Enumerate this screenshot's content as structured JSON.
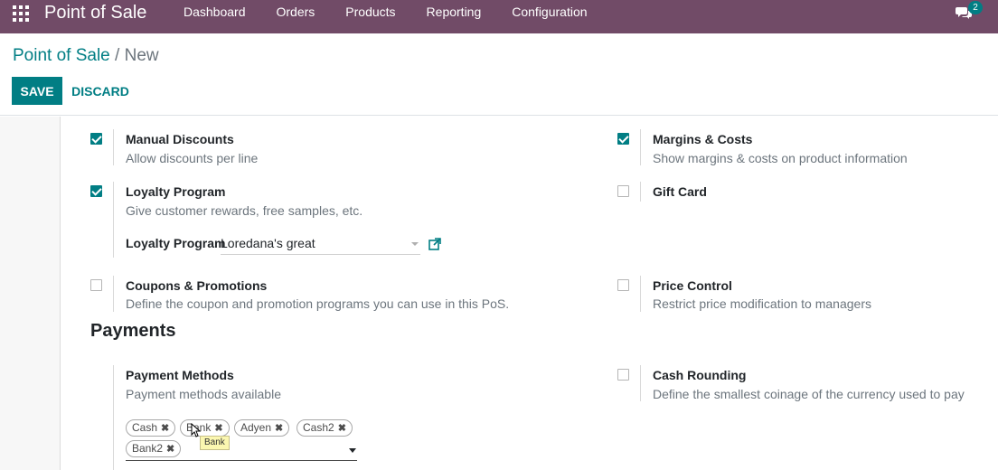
{
  "navbar": {
    "brand": "Point of Sale",
    "menu": [
      "Dashboard",
      "Orders",
      "Products",
      "Reporting",
      "Configuration"
    ],
    "chat_badge": "2",
    "apps_icon": "grid-apps-icon",
    "chat_icon": "chat-bubbles-icon"
  },
  "breadcrumb": {
    "parent": "Point of Sale",
    "separator": "/",
    "current": "New"
  },
  "buttons": {
    "save": "SAVE",
    "discard": "DISCARD"
  },
  "settings": {
    "manual_discounts": {
      "title": "Manual Discounts",
      "desc": "Allow discounts per line",
      "checked": true
    },
    "margins_costs": {
      "title": "Margins & Costs",
      "desc": "Show margins & costs on product information",
      "checked": true
    },
    "loyalty_program": {
      "title": "Loyalty Program",
      "desc": "Give customer rewards, free samples, etc.",
      "checked": true,
      "field_label": "Loyalty Program",
      "field_value": "Loredana's great"
    },
    "gift_card": {
      "title": "Gift Card",
      "checked": false
    },
    "coupons_promotions": {
      "title": "Coupons & Promotions",
      "desc": "Define the coupon and promotion programs you can use in this PoS.",
      "checked": false
    },
    "price_control": {
      "title": "Price Control",
      "desc": "Restrict price modification to managers",
      "checked": false
    }
  },
  "payments": {
    "section_title": "Payments",
    "payment_methods": {
      "title": "Payment Methods",
      "desc": "Payment methods available",
      "tags": [
        "Cash",
        "Bank",
        "Adyen",
        "Cash2",
        "Bank2"
      ],
      "tooltip": "Bank"
    },
    "cash_rounding": {
      "title": "Cash Rounding",
      "desc": "Define the smallest coinage of the currency used to pay",
      "checked": false
    }
  },
  "colors": {
    "navbar": "#714B67",
    "accent": "#017E84"
  }
}
